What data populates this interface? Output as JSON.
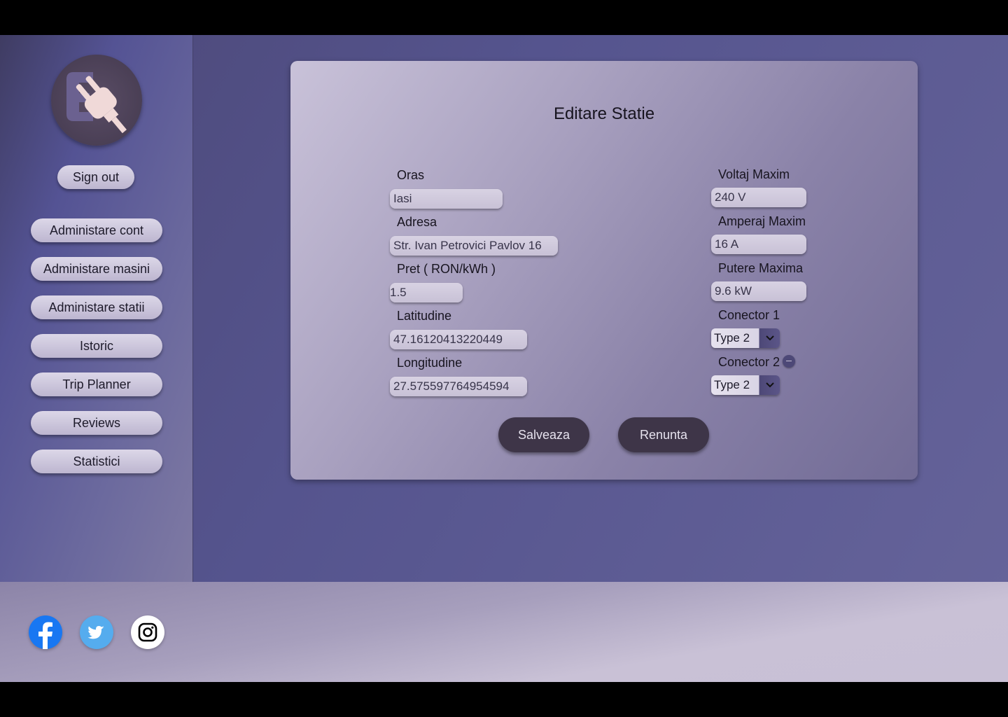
{
  "sidebar": {
    "sign_out": "Sign out",
    "items": [
      {
        "label": "Administare cont"
      },
      {
        "label": "Administare masini"
      },
      {
        "label": "Administare statii"
      },
      {
        "label": "Istoric"
      },
      {
        "label": "Trip Planner"
      },
      {
        "label": "Reviews"
      },
      {
        "label": "Statistici"
      }
    ]
  },
  "form": {
    "title": "Editare Statie",
    "left": {
      "oras": {
        "label": "Oras",
        "value": "Iasi"
      },
      "adresa": {
        "label": "Adresa",
        "value": "Str. Ivan Petrovici Pavlov 16"
      },
      "pret": {
        "label": "Pret ( RON/kWh )",
        "value": "1.5"
      },
      "latitudine": {
        "label": "Latitudine",
        "value": "47.16120413220449"
      },
      "longitudine": {
        "label": "Longitudine",
        "value": "27.575597764954594"
      }
    },
    "right": {
      "voltaj": {
        "label": "Voltaj Maxim",
        "value": "240 V"
      },
      "amperaj": {
        "label": "Amperaj Maxim",
        "value": "16 A"
      },
      "putere": {
        "label": "Putere Maxima",
        "value": "9.6 kW"
      },
      "conector1": {
        "label": "Conector 1",
        "value": "Type 2"
      },
      "conector2": {
        "label": "Conector 2",
        "value": "Type 2"
      }
    },
    "save": "Salveaza",
    "cancel": "Renunta"
  },
  "footer": {
    "social": [
      "facebook-icon",
      "twitter-icon",
      "instagram-icon"
    ]
  },
  "colors": {
    "accent": "#4d4877",
    "button_dark": "#3e3548",
    "facebook": "#1877f2",
    "twitter": "#55acee"
  }
}
